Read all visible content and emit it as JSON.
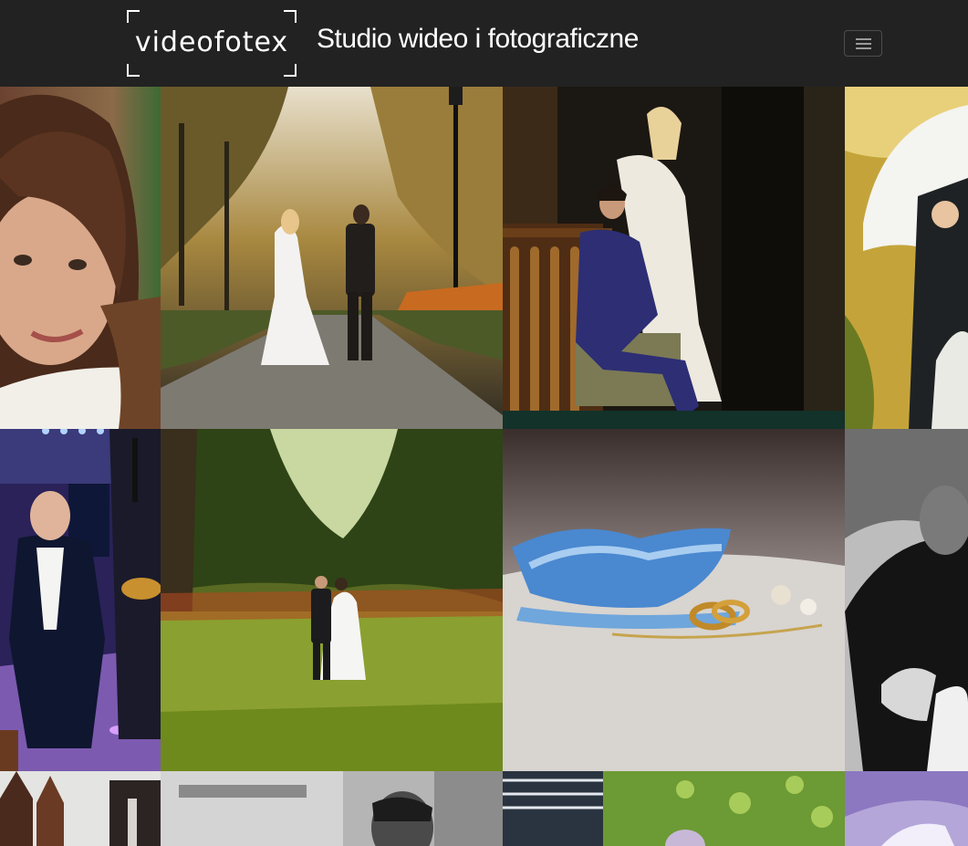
{
  "header": {
    "logo_text": "videofotex",
    "title": "Studio wideo i fotograficzne",
    "menu_icon": "hamburger-icon"
  },
  "gallery": {
    "photos": [
      {
        "row": 0,
        "col": 0,
        "subject": "portrait-woman"
      },
      {
        "row": 0,
        "col": 1,
        "subject": "couple-autumn-park-path"
      },
      {
        "row": 0,
        "col": 2,
        "subject": "couple-armchair-dark-room"
      },
      {
        "row": 0,
        "col": 3,
        "subject": "couple-umbrella"
      },
      {
        "row": 1,
        "col": 0,
        "subject": "groom-reception-stage"
      },
      {
        "row": 1,
        "col": 1,
        "subject": "couple-green-meadow"
      },
      {
        "row": 1,
        "col": 2,
        "subject": "garter-and-rings"
      },
      {
        "row": 1,
        "col": 3,
        "subject": "couple-embrace-bw"
      },
      {
        "row": 2,
        "col": 0,
        "subject": "church-towers"
      },
      {
        "row": 2,
        "col": 1,
        "subject": "groom-bw"
      },
      {
        "row": 2,
        "col": 2,
        "subject": "couple-ivy-pergola"
      },
      {
        "row": 2,
        "col": 3,
        "subject": "couple-purple"
      }
    ]
  }
}
